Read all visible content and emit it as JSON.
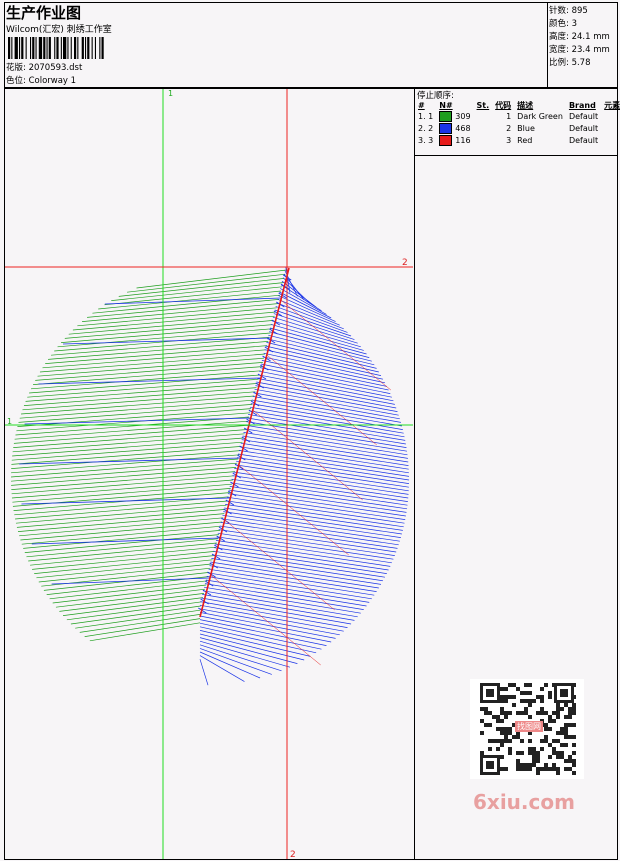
{
  "header": {
    "title": "生产作业图",
    "company": "Wilcom(汇宏) 刺绣工作室",
    "design_label": "花版: 2070593.dst",
    "colorway_label": "色位: Colorway 1"
  },
  "stats": {
    "stitches": "针数: 895",
    "colors": "颜色: 3",
    "height": "高度: 24.1 mm",
    "width": "宽度: 23.4 mm",
    "scale": "比例: 5.78"
  },
  "stop_sequence": {
    "title": "停止顺序:",
    "headers": [
      "#",
      "N#",
      "St.",
      "代码",
      "描述",
      "Brand",
      "元素"
    ],
    "rows": [
      {
        "idx": "1. 1",
        "color": "#1e9e1e",
        "stitches": "309",
        "code": "1",
        "desc": "Dark Green",
        "brand": "Default"
      },
      {
        "idx": "2. 2",
        "color": "#1a33e6",
        "stitches": "468",
        "code": "2",
        "desc": "Blue",
        "brand": "Default"
      },
      {
        "idx": "3. 3",
        "color": "#e61a1a",
        "stitches": "116",
        "code": "3",
        "desc": "Red",
        "brand": "Default"
      }
    ]
  },
  "axis_labels": {
    "green_top": "1",
    "green_left": "1",
    "red_right": "2",
    "red_bottom": "2"
  },
  "watermark": {
    "text": "6xiu.com",
    "qr_caption": "找图网"
  },
  "colors": {
    "green": "#1e9e1e",
    "blue": "#1a33e6",
    "red": "#e61a1a",
    "guide_green": "#22dd22",
    "guide_red": "#ee2222"
  }
}
